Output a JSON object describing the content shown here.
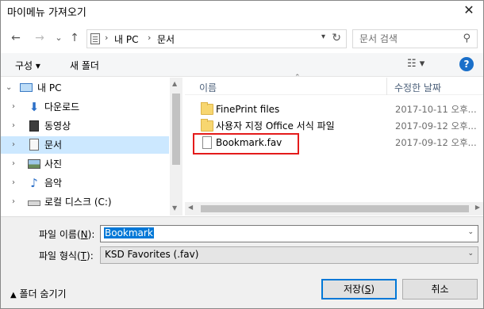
{
  "window": {
    "title": "마이메뉴 가져오기",
    "close_glyph": "✕"
  },
  "nav": {
    "back": "←",
    "forward": "→",
    "recent": "⌄",
    "up": "↑"
  },
  "address": {
    "crumbs": [
      "내 PC",
      "문서"
    ]
  },
  "search": {
    "placeholder": "문서 검색"
  },
  "toolbar": {
    "organize": "구성 ▾",
    "new_folder": "새 폴더"
  },
  "tree": {
    "items": [
      {
        "label": "내 PC",
        "icon": "monitor-icon"
      },
      {
        "label": "다운로드",
        "icon": "download-arrow-icon"
      },
      {
        "label": "동영상",
        "icon": "film-icon"
      },
      {
        "label": "문서",
        "icon": "document-icon",
        "selected": true
      },
      {
        "label": "사진",
        "icon": "picture-icon"
      },
      {
        "label": "음악",
        "icon": "music-note-icon"
      },
      {
        "label": "로컬 디스크 (C:)",
        "icon": "drive-icon"
      }
    ]
  },
  "columns": {
    "name": "이름",
    "modified": "수정한 날짜"
  },
  "files": [
    {
      "name": "FinePrint files",
      "date": "2017-10-11 오후...",
      "type": "folder"
    },
    {
      "name": "사용자 지정 Office 서식 파일",
      "date": "2017-09-12 오후...",
      "type": "folder"
    },
    {
      "name": "Bookmark.fav",
      "date": "2017-09-12 오후...",
      "type": "file"
    }
  ],
  "form": {
    "filename_label_prefix": "파일 이름(",
    "filename_label_key": "N",
    "filename_label_suffix": "):",
    "filename_value": "Bookmark",
    "filetype_label_prefix": "파일 형식(",
    "filetype_label_key": "T",
    "filetype_label_suffix": "):",
    "filetype_value": "KSD Favorites (.fav)"
  },
  "footer": {
    "hide_folders": "폴더 숨기기",
    "save_prefix": "저장(",
    "save_key": "S",
    "save_suffix": ")",
    "cancel": "취소"
  },
  "colors": {
    "accent": "#0078d7",
    "highlight_box": "#e41b1b",
    "selected_row": "#cce8ff"
  }
}
